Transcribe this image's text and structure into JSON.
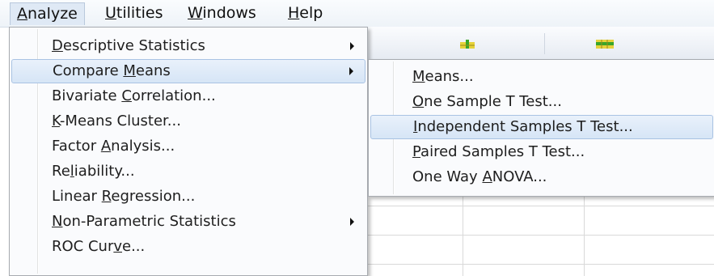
{
  "menubar": {
    "items": [
      {
        "pre": "",
        "acc": "A",
        "post": "nalyze"
      },
      {
        "pre": "",
        "acc": "U",
        "post": "tilities"
      },
      {
        "pre": "",
        "acc": "W",
        "post": "indows"
      },
      {
        "pre": "",
        "acc": "H",
        "post": "elp"
      }
    ]
  },
  "analyze_menu": {
    "items": [
      {
        "pre": "",
        "acc": "D",
        "post": "escriptive Statistics"
      },
      {
        "pre": "Compare ",
        "acc": "M",
        "post": "eans"
      },
      {
        "pre": "Bivariate ",
        "acc": "C",
        "post": "orrelation..."
      },
      {
        "pre": "",
        "acc": "K",
        "post": "-Means Cluster..."
      },
      {
        "pre": "Factor ",
        "acc": "A",
        "post": "nalysis..."
      },
      {
        "pre": "Re",
        "acc": "l",
        "post": "iability..."
      },
      {
        "pre": "Linear ",
        "acc": "R",
        "post": "egression..."
      },
      {
        "pre": "",
        "acc": "N",
        "post": "on-Parametric Statistics"
      },
      {
        "pre": "ROC Cur",
        "acc": "v",
        "post": "e..."
      }
    ]
  },
  "compare_means_menu": {
    "items": [
      {
        "pre": "",
        "acc": "M",
        "post": "eans..."
      },
      {
        "pre": "",
        "acc": "O",
        "post": "ne Sample T Test..."
      },
      {
        "pre": "",
        "acc": "I",
        "post": "ndependent Samples T Test..."
      },
      {
        "pre": "",
        "acc": "P",
        "post": "aired Samples T Test..."
      },
      {
        "pre": "One Way ",
        "acc": "A",
        "post": "NOVA..."
      }
    ]
  },
  "toolbar": {
    "icons": [
      "insert-variable-icon",
      "insert-case-icon"
    ]
  },
  "colors": {
    "highlight": "#d6e5f6",
    "icon_green": "#3aa52a",
    "icon_yellow": "#e6d23a"
  }
}
